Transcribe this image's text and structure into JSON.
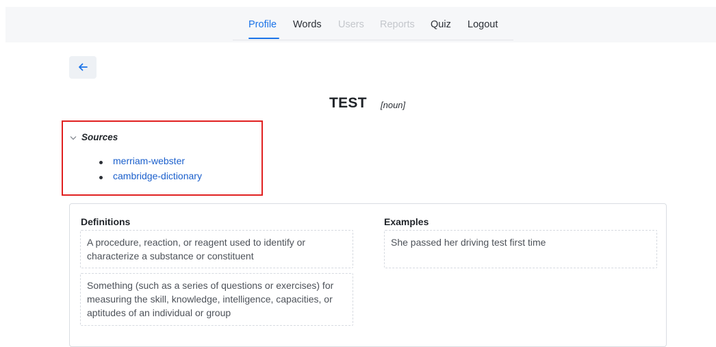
{
  "nav": {
    "items": [
      {
        "label": "Profile",
        "state": "active"
      },
      {
        "label": "Words",
        "state": "normal"
      },
      {
        "label": "Users",
        "state": "disabled"
      },
      {
        "label": "Reports",
        "state": "disabled"
      },
      {
        "label": "Quiz",
        "state": "normal"
      },
      {
        "label": "Logout",
        "state": "normal"
      }
    ]
  },
  "back_button": {
    "icon": "arrow-left-icon"
  },
  "word": {
    "title": "TEST",
    "part_of_speech": "[noun]"
  },
  "sources": {
    "label": "Sources",
    "expanded": true,
    "items": [
      "merriam-webster",
      "cambridge-dictionary"
    ]
  },
  "definitions": {
    "title": "Definitions",
    "items": [
      "A procedure, reaction, or reagent used to identify or characterize a substance or constituent",
      "Something (such as a series of questions or exercises) for measuring the skill, knowledge, intelligence, capacities, or aptitudes of an individual or group"
    ]
  },
  "examples": {
    "title": "Examples",
    "items": [
      "She passed her driving test first time"
    ]
  },
  "colors": {
    "accent": "#1a73e8",
    "link": "#1a5fcc",
    "highlight_border": "#e02020"
  }
}
